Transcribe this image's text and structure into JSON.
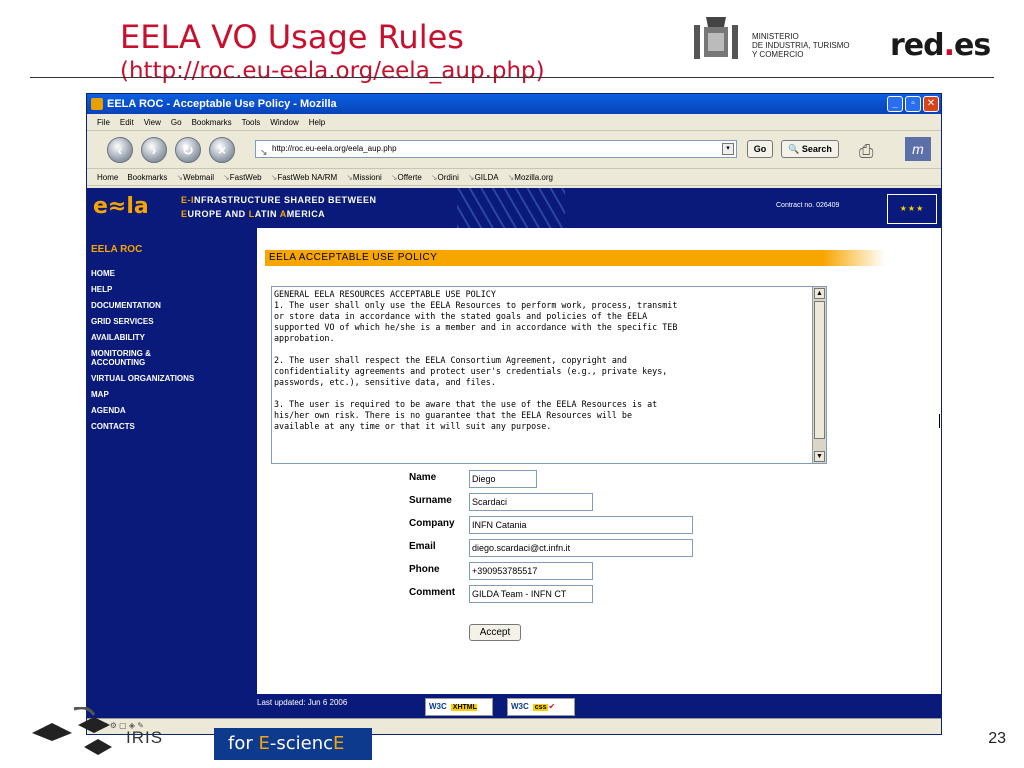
{
  "slide": {
    "title": "EELA VO Usage Rules",
    "url": "(http://roc.eu-eela.org/eela_aup.php)",
    "ministry": [
      "MINISTERIO",
      "DE INDUSTRIA, TURISMO",
      "Y COMERCIO"
    ],
    "reds_logo": "red.es",
    "page_number": "23",
    "bottom_logo_text": "IRIS",
    "escience_prefix": "for ",
    "escience_e1": "E",
    "escience_mid": "-scienc",
    "escience_e2": "E"
  },
  "browser": {
    "window_title": "EELA ROC - Acceptable Use Policy - Mozilla",
    "menu": [
      "File",
      "Edit",
      "View",
      "Go",
      "Bookmarks",
      "Tools",
      "Window",
      "Help"
    ],
    "address": "http://roc.eu-eela.org/eela_aup.php",
    "go_label": "Go",
    "search_label": "Search",
    "bookmarks": [
      "Home",
      "Bookmarks",
      "Webmail",
      "FastWeb",
      "FastWeb NA/RM",
      "Missioni",
      "Offerte",
      "Ordini",
      "GILDA",
      "Mozilla.org"
    ]
  },
  "page": {
    "banner_line1a": "E-I",
    "banner_line1b": "NFRASTRUCTURE SHARED BETWEEN",
    "banner_line2a": "E",
    "banner_line2b": "UROPE AND ",
    "banner_line2c": "L",
    "banner_line2d": "ATIN ",
    "banner_line2e": "A",
    "banner_line2f": "MERICA",
    "contract": "Contract no. 026409",
    "sidebar_title": "EELA ROC",
    "sidebar_items": [
      "HOME",
      "HELP",
      "DOCUMENTATION",
      "GRID SERVICES",
      "AVAILABILITY",
      "MONITORING & ACCOUNTING",
      "VIRTUAL ORGANIZATIONS",
      "MAP",
      "AGENDA",
      "CONTACTS"
    ],
    "policy_heading": "EELA ACCEPTABLE USE POLICY",
    "policy_text": "GENERAL EELA RESOURCES ACCEPTABLE USE POLICY\n1. The user shall only use the EELA Resources to perform work, process, transmit\nor store data in accordance with the stated goals and policies of the EELA\nsupported VO of which he/she is a member and in accordance with the specific TEB\napprobation.\n\n2. The user shall respect the EELA Consortium Agreement, copyright and\nconfidentiality agreements and protect user's credentials (e.g., private keys,\npasswords, etc.), sensitive data, and files.\n\n3. The user is required to be aware that the use of the EELA Resources is at\nhis/her own risk. There is no guarantee that the EELA Resources will be\navailable at any time or that it will suit any purpose.",
    "form": {
      "name_label": "Name",
      "name_value": "Diego",
      "surname_label": "Surname",
      "surname_value": "Scardaci",
      "company_label": "Company",
      "company_value": "INFN Catania",
      "email_label": "Email",
      "email_value": "diego.scardaci@ct.infn.it",
      "phone_label": "Phone",
      "phone_value": "+390953785517",
      "comment_label": "Comment",
      "comment_value": "GILDA Team - INFN CT",
      "accept_label": "Accept"
    },
    "last_updated": "Last updated: Jun 6 2006",
    "badge_xhtml": "XHTML 1.0",
    "badge_css": "css"
  },
  "colors": {
    "title_red": "#c8102e",
    "site_blue": "#0a1a7a",
    "accent_orange": "#f7a600"
  }
}
